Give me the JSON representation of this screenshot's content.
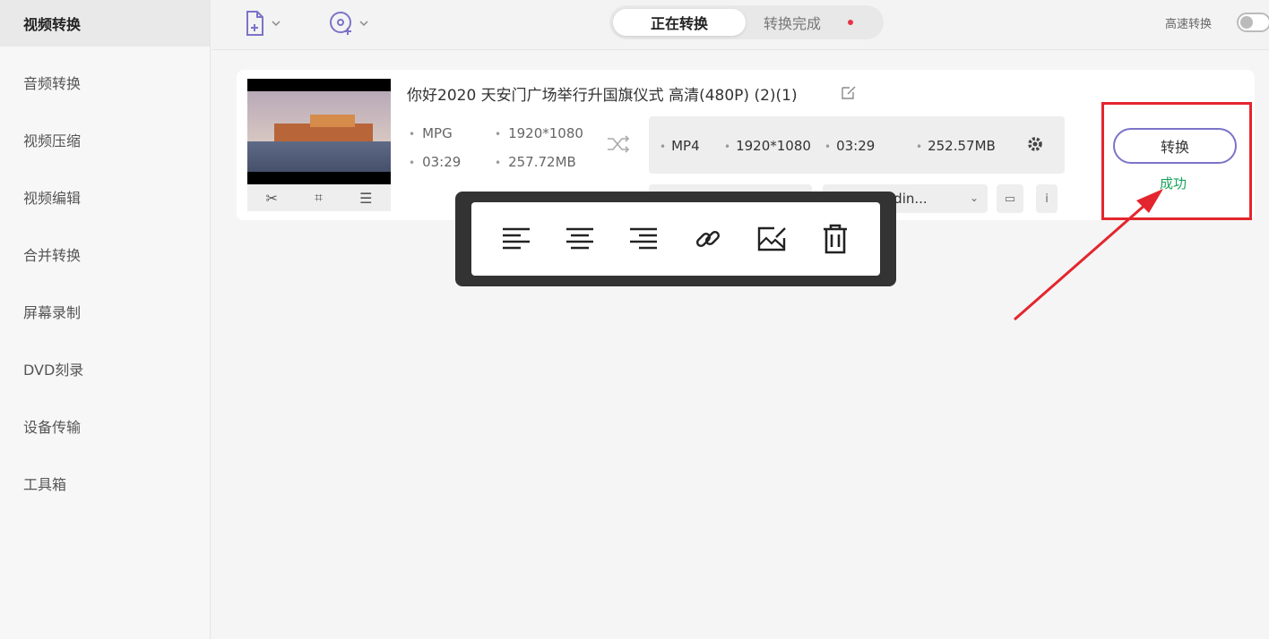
{
  "sidebar": {
    "items": [
      {
        "label": "视频转换",
        "active": true
      },
      {
        "label": "音频转换"
      },
      {
        "label": "视频压缩"
      },
      {
        "label": "视频编辑"
      },
      {
        "label": "合并转换"
      },
      {
        "label": "屏幕录制"
      },
      {
        "label": "DVD刻录"
      },
      {
        "label": "设备传输"
      },
      {
        "label": "工具箱"
      }
    ]
  },
  "header": {
    "tabs": [
      {
        "label": "正在转换",
        "active": true
      },
      {
        "label": "转换完成"
      }
    ],
    "high_speed_label": "高速转换",
    "high_speed_on": false,
    "accent": "#7b73c9",
    "dot_color": "#e8334a"
  },
  "file": {
    "title": "你好2020 天安门广场举行升国旗仪式 高清(480P) (2)(1)",
    "source": {
      "format": "MPG",
      "resolution": "1920*1080",
      "duration": "03:29",
      "size": "257.72MB"
    },
    "output": {
      "format": "MP4",
      "resolution": "1920*1080",
      "duration": "03:29",
      "size": "252.57MB"
    },
    "dropdown_1": "",
    "dropdown_2": "odin...",
    "convert_label": "转换",
    "status": "成功",
    "status_color": "#19a35b"
  },
  "format_toolbar": {
    "buttons": [
      "align-left-icon",
      "align-center-icon",
      "align-right-icon",
      "link-icon",
      "image-edit-icon",
      "trash-icon"
    ]
  },
  "annotation": {
    "highlight_color": "#e3262e"
  }
}
